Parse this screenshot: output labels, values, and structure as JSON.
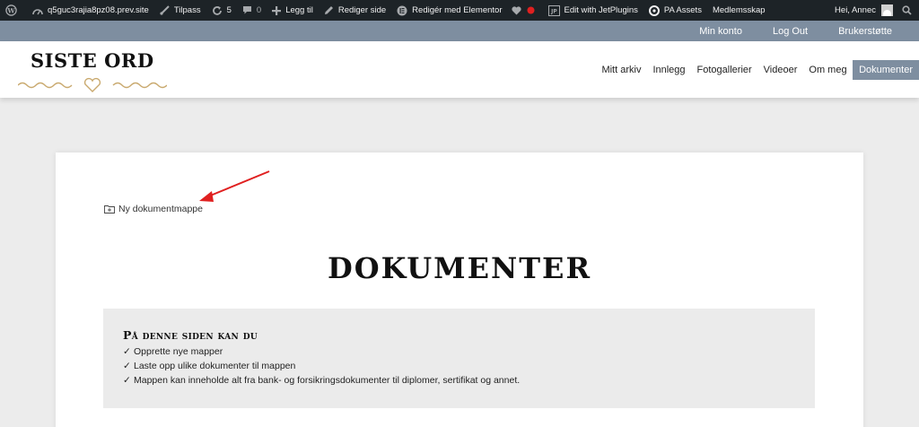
{
  "adminbar": {
    "site": "q5guc3rajia8pz08.prev.site",
    "customize": "Tilpass",
    "updates_count": "5",
    "comments_count": "0",
    "new": "Legg til",
    "edit_page": "Rediger side",
    "elementor": "Redigér med Elementor",
    "jetplugins": "Edit with JetPlugins",
    "pa_assets": "PA Assets",
    "membership": "Medlemsskap",
    "greeting": "Hei, Annec"
  },
  "topbar": {
    "items": [
      "Min konto",
      "Log Out",
      "Brukerstøtte"
    ]
  },
  "logo": {
    "text": "SISTE ORD"
  },
  "nav": {
    "items": [
      "Mitt arkiv",
      "Innlegg",
      "Fotogallerier",
      "Videoer",
      "Om meg",
      "Dokumenter"
    ],
    "active": "Dokumenter"
  },
  "page": {
    "new_folder": "Ny dokumentmappe",
    "title": "DOKUMENTER",
    "info_heading": "På denne siden kan du",
    "info_items": [
      "Opprette nye mapper",
      "Laste opp ulike dokumenter til mappen",
      "Mappen kan inneholde alt fra bank- og forsikringsdokumenter til diplomer, sertifikat og annet."
    ],
    "check": "✓"
  },
  "colors": {
    "adminbar": "#1d2327",
    "accent": "#7e8ea0",
    "logo_ornament": "#c9a96e",
    "arrow": "#e02020"
  }
}
